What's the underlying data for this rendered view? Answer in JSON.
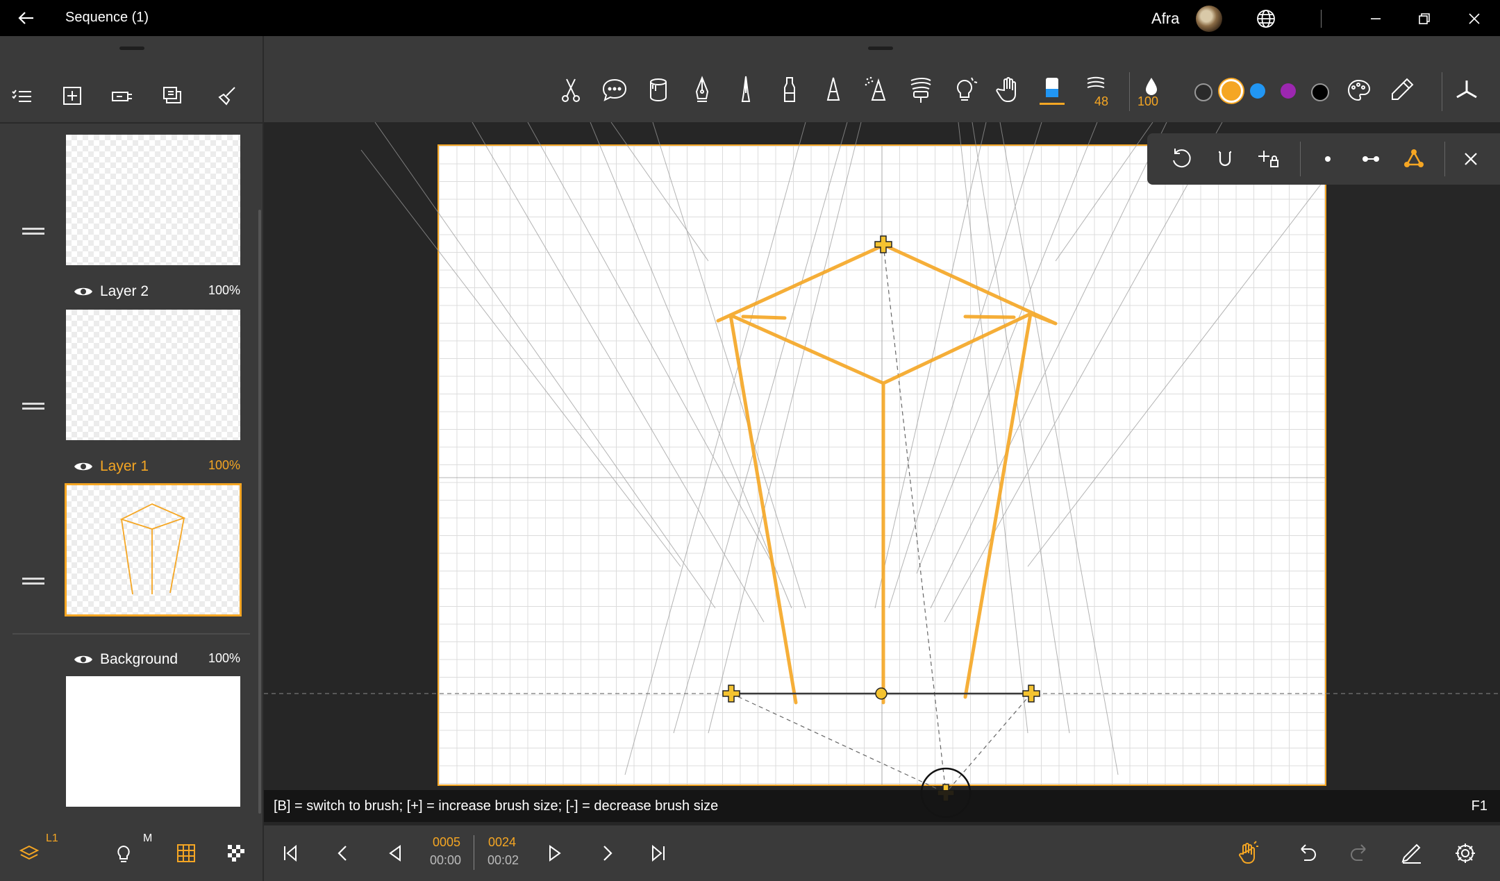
{
  "window": {
    "title": "Sequence (1)",
    "user": "Afra"
  },
  "colors": {
    "accent": "#f5a623",
    "panel": "#3a3a3a",
    "canvas_bg": "#262626"
  },
  "left_toolbar": [
    "list-check-icon",
    "add-layer-icon",
    "merge-layer-icon",
    "duplicate-layer-icon",
    "brush-clean-icon"
  ],
  "layers": [
    {
      "name": "",
      "opacity": "",
      "visible": true,
      "active": false
    },
    {
      "name": "Layer 2",
      "opacity": "100%",
      "visible": true,
      "active": false
    },
    {
      "name": "Layer 1",
      "opacity": "100%",
      "visible": true,
      "active": true
    },
    {
      "name": "Background",
      "opacity": "100%",
      "visible": true,
      "active": false
    }
  ],
  "toolbar": {
    "tools": [
      "scissors-icon",
      "speech-bubble-icon",
      "bucket-icon",
      "pen-nib-icon",
      "fine-pen-icon",
      "marker-icon",
      "pencil-icon",
      "airbrush-icon",
      "roller-icon",
      "idea-icon",
      "hand-icon",
      "eraser-icon"
    ],
    "active_tool": "eraser-icon",
    "brush_size": "48",
    "opacity": "100",
    "swatches": [
      "#2a2a2a",
      "#f5a623",
      "#2196f3",
      "#9c27b0",
      "#000000"
    ],
    "active_swatch": "#f5a623"
  },
  "perspective_bar": {
    "buttons": [
      "reset-icon",
      "magnet-icon",
      "add-lock-icon",
      "one-point-icon",
      "two-point-icon",
      "three-point-icon",
      "close-icon"
    ],
    "active": "three-point-icon"
  },
  "status": {
    "hint": "[B] = switch to brush; [+] = increase brush size; [-] = decrease brush size",
    "shortcut": "F1"
  },
  "timeline": {
    "current_frame": "0005",
    "current_time": "00:00",
    "total_frames": "0024",
    "total_time": "00:02"
  },
  "bottom_left": {
    "layer_label": "L1",
    "mode_label": "M"
  }
}
